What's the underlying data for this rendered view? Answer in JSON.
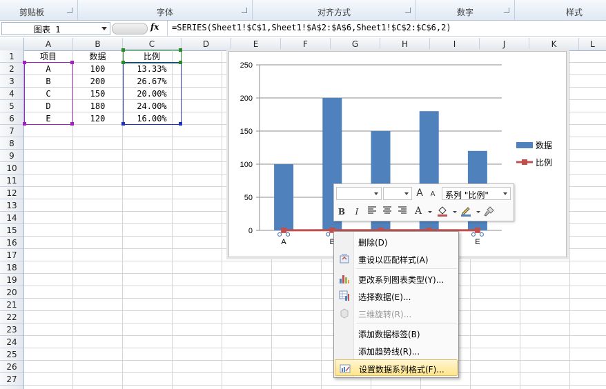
{
  "ribbon": {
    "groups": [
      {
        "label": "剪贴板"
      },
      {
        "label": "字体"
      },
      {
        "label": "对齐方式"
      },
      {
        "label": "数字"
      },
      {
        "label": "样式"
      }
    ]
  },
  "formula_bar": {
    "name_box": "图表 1",
    "fx": "fx",
    "formula": "=SERIES(Sheet1!$C$1,Sheet1!$A$2:$A$6,Sheet1!$C$2:$C$6,2)"
  },
  "columns": [
    "A",
    "B",
    "C",
    "D",
    "E",
    "F",
    "G",
    "H",
    "I",
    "J",
    "K",
    "L"
  ],
  "rows": [
    "1",
    "2",
    "3",
    "4",
    "5",
    "6",
    "7",
    "8",
    "9",
    "10",
    "11",
    "12",
    "13",
    "14",
    "15",
    "16",
    "17",
    "18",
    "19",
    "20",
    "21",
    "22",
    "23",
    "24",
    "25",
    "26",
    "27"
  ],
  "sheet": {
    "header": {
      "a": "项目",
      "b": "数据",
      "c": "比例"
    },
    "data": [
      {
        "a": "A",
        "b": "100",
        "c": "13.33%"
      },
      {
        "a": "B",
        "b": "200",
        "c": "26.67%"
      },
      {
        "a": "C",
        "b": "150",
        "c": "20.00%"
      },
      {
        "a": "D",
        "b": "180",
        "c": "24.00%"
      },
      {
        "a": "E",
        "b": "120",
        "c": "16.00%"
      }
    ]
  },
  "chart_data": {
    "type": "bar",
    "categories": [
      "A",
      "B",
      "C",
      "D",
      "E"
    ],
    "series": [
      {
        "name": "数据",
        "type": "bar",
        "values": [
          100,
          200,
          150,
          180,
          120
        ],
        "color": "#4f81bd"
      },
      {
        "name": "比例",
        "type": "line",
        "values": [
          0.1333,
          0.2667,
          0.2,
          0.24,
          0.16
        ],
        "color": "#c0504d"
      }
    ],
    "yticks": [
      "0",
      "50",
      "100",
      "150",
      "200",
      "250"
    ],
    "ylim": [
      0,
      250
    ],
    "grid": true,
    "legend": "right"
  },
  "mini_toolbar": {
    "series_selector": "系列 \"比例\"",
    "grow_font": "A",
    "shrink_font": "A",
    "bold": "B",
    "italic": "I",
    "font_color": "A"
  },
  "context_menu": {
    "items": [
      {
        "label": "删除(D)",
        "icon": "none",
        "disabled": false
      },
      {
        "label": "重设以匹配样式(A)",
        "icon": "reset-style-icon",
        "disabled": false
      },
      {
        "label": "更改系列图表类型(Y)...",
        "icon": "chart-type-icon",
        "disabled": false
      },
      {
        "label": "选择数据(E)...",
        "icon": "select-data-icon",
        "disabled": false
      },
      {
        "label": "三维旋转(R)...",
        "icon": "3d-rotation-icon",
        "disabled": true
      },
      {
        "label": "添加数据标签(B)",
        "icon": "none",
        "disabled": false
      },
      {
        "label": "添加趋势线(R)...",
        "icon": "none",
        "disabled": false
      },
      {
        "label": "设置数据系列格式(F)...",
        "icon": "format-series-icon",
        "disabled": false,
        "highlighted": true
      }
    ]
  }
}
